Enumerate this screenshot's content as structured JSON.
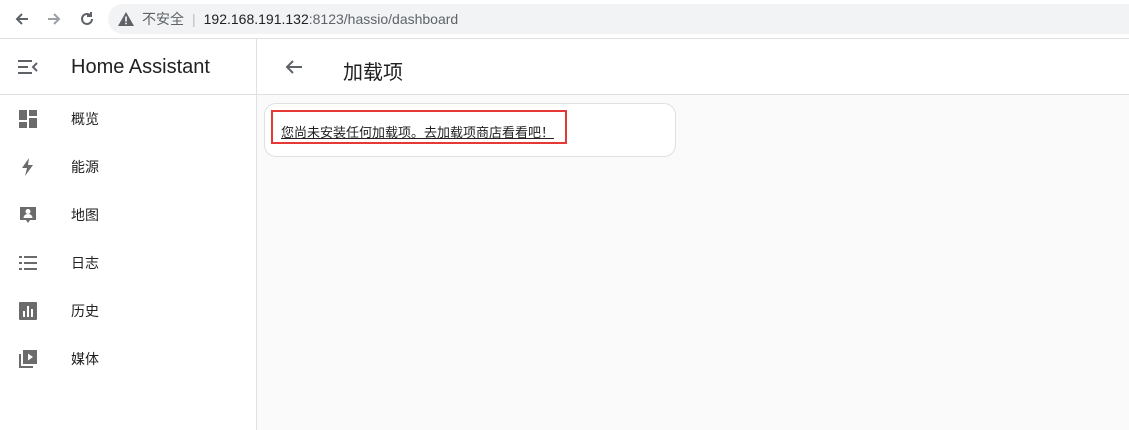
{
  "browser": {
    "insecure_label": "不安全",
    "separator": "|",
    "url_host": "192.168.191.132",
    "url_rest": ":8123/hassio/dashboard",
    "icons": {
      "back": "arrow-left-icon",
      "forward": "arrow-right-icon",
      "reload": "reload-icon",
      "warning": "warning-triangle-icon"
    }
  },
  "sidebar": {
    "title": "Home Assistant",
    "items": [
      {
        "label": "概览",
        "icon": "dashboard-icon"
      },
      {
        "label": "能源",
        "icon": "lightning-bolt-icon"
      },
      {
        "label": "地图",
        "icon": "map-person-icon"
      },
      {
        "label": "日志",
        "icon": "list-icon"
      },
      {
        "label": "历史",
        "icon": "chart-box-icon"
      },
      {
        "label": "媒体",
        "icon": "media-play-icon"
      }
    ]
  },
  "main": {
    "title": "加载项",
    "message": "您尚未安装任何加载项。去加载项商店看看吧！"
  },
  "colors": {
    "highlight": "#e53935",
    "background": "#fafafa"
  }
}
